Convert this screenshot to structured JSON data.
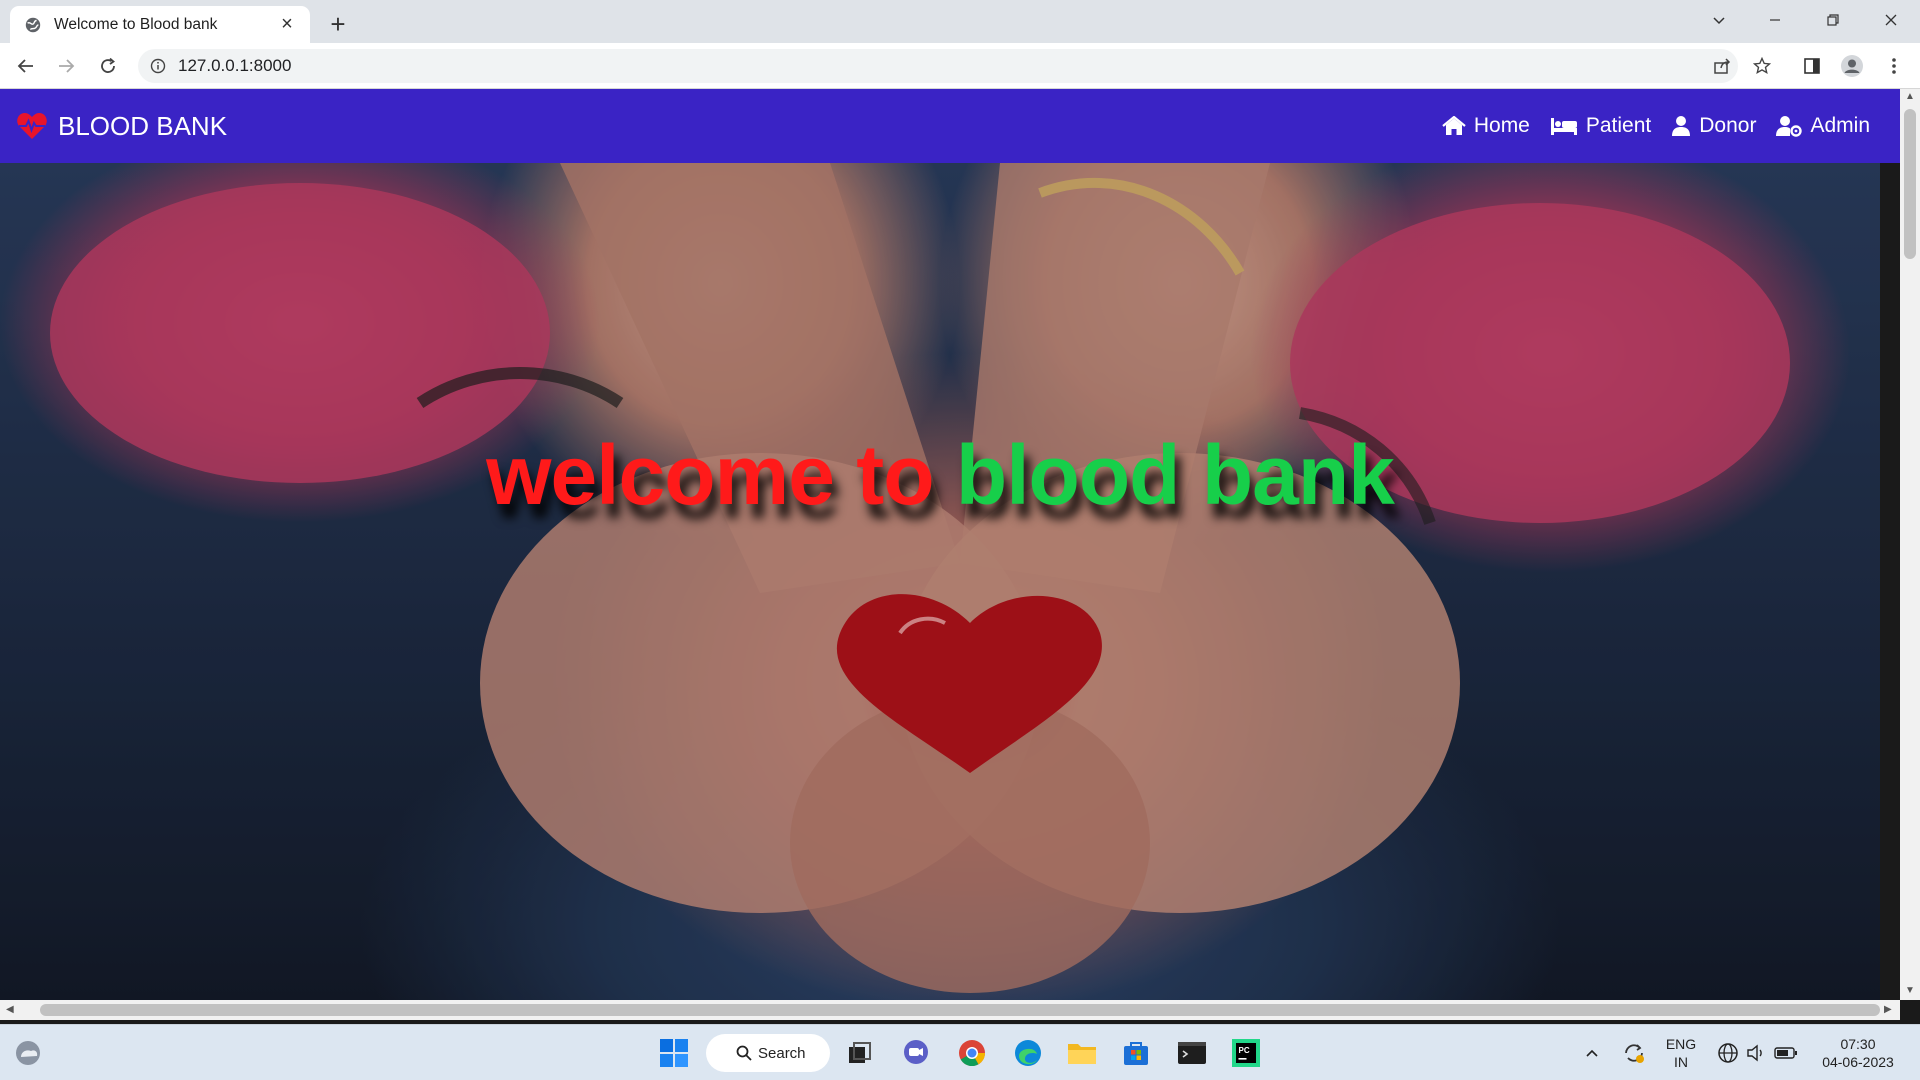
{
  "browser": {
    "tab_title": "Welcome to Blood bank",
    "url": "127.0.0.1:8000"
  },
  "navbar": {
    "brand": "BLOOD BANK",
    "links": [
      {
        "label": "Home",
        "icon": "home-icon"
      },
      {
        "label": "Patient",
        "icon": "bed-icon"
      },
      {
        "label": "Donor",
        "icon": "user-icon"
      },
      {
        "label": "Admin",
        "icon": "user-cog-icon"
      }
    ]
  },
  "hero": {
    "title_part1": "welcome to",
    "title_part2": "blood bank",
    "colors": {
      "part1": "#ff1a1a",
      "part2": "#17cf4a"
    }
  },
  "taskbar": {
    "search_label": "Search",
    "language": "ENG",
    "region": "IN",
    "time": "07:30",
    "date": "04-06-2023"
  },
  "colors": {
    "navbar": "#3a23c5"
  }
}
